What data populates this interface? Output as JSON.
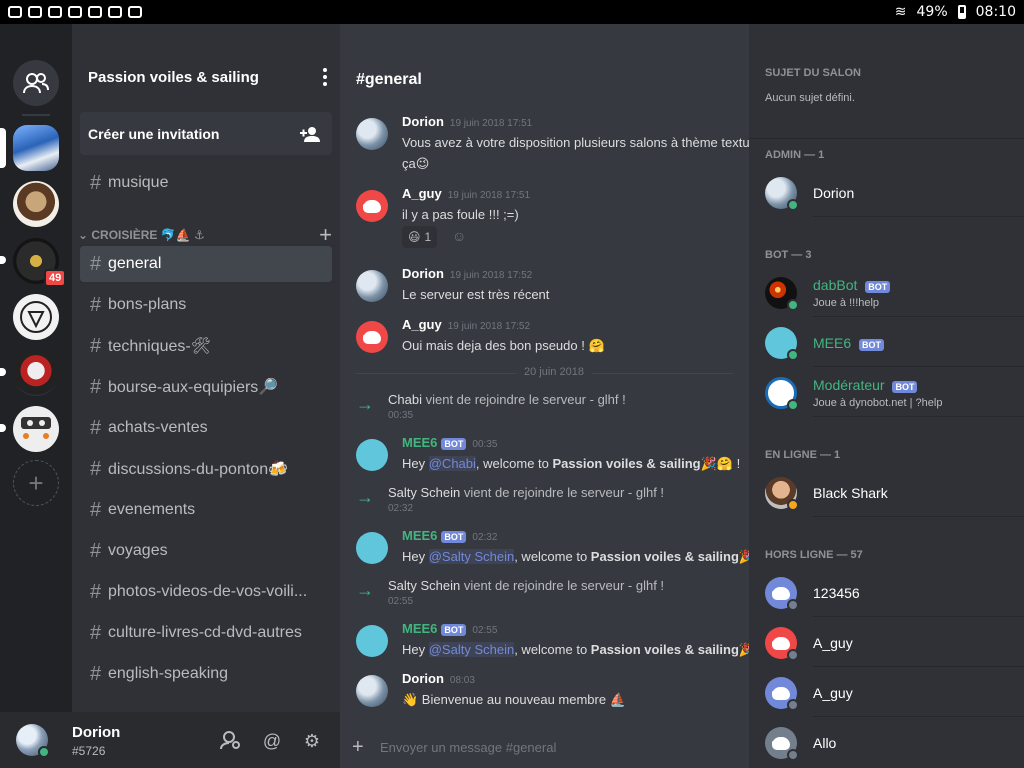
{
  "status_bar": {
    "battery": "49%",
    "time": "08:10"
  },
  "server": {
    "name": "Passion voiles & sailing",
    "invite_label": "Créer une invitation"
  },
  "channels_top": [
    {
      "name": "musique"
    }
  ],
  "category": {
    "name": "CROISIÈRE 🐬⛵ ⚓"
  },
  "channels": [
    {
      "name": "general",
      "active": true
    },
    {
      "name": "bons-plans"
    },
    {
      "name": "techniques-🛠"
    },
    {
      "name": "bourse-aux-equipiers🔎"
    },
    {
      "name": "achats-ventes"
    },
    {
      "name": "discussions-du-ponton🍻"
    },
    {
      "name": "evenements"
    },
    {
      "name": "voyages"
    },
    {
      "name": "photos-videos-de-vos-voili..."
    },
    {
      "name": "culture-livres-cd-dvd-autres"
    },
    {
      "name": "english-speaking"
    }
  ],
  "guild_badge": "49",
  "user": {
    "name": "Dorion",
    "tag": "#5726"
  },
  "chat": {
    "title": "#general",
    "messages": [
      {
        "author": "Dorion",
        "time": "19 juin 2018 17:51",
        "text": "Vous avez à votre disposition plusieurs salons à thème textu",
        "text2": "ça😉"
      },
      {
        "author": "A_guy",
        "time": "19 juin 2018 17:51",
        "text": "il y a pas foule !!! ;=)",
        "reaction_count": "1"
      },
      {
        "author": "Dorion",
        "time": "19 juin 2018 17:52",
        "text": "Le serveur est très récent"
      },
      {
        "author": "A_guy",
        "time": "19 juin 2018 17:52",
        "text": "Oui mais deja des bon pseudo ! 🤗"
      }
    ],
    "date_divider": "20 juin 2018",
    "joins": [
      {
        "name": "Chabi",
        "suffix": "vient de rejoindre le serveur - glhf !",
        "time": "00:35"
      },
      {
        "name": "Salty Schein",
        "suffix": "vient de rejoindre le serveur - glhf !",
        "time": "02:32"
      },
      {
        "name": "Salty Schein",
        "suffix": "vient de rejoindre le serveur - glhf !",
        "time": "02:55"
      }
    ],
    "mee6": [
      {
        "author": "MEE6",
        "time": "00:35",
        "pre": "Hey ",
        "mention": "@Chabi",
        "post": ", welcome to ",
        "server": "Passion voiles & sailing",
        "end": "🎉🤗 !"
      },
      {
        "author": "MEE6",
        "time": "02:32",
        "pre": "Hey ",
        "mention": "@Salty Schein",
        "post": ", welcome to ",
        "server": "Passion voiles & sailing",
        "end": "🎉"
      },
      {
        "author": "MEE6",
        "time": "02:55",
        "pre": "Hey ",
        "mention": "@Salty Schein",
        "post": ", welcome to ",
        "server": "Passion voiles & sailing",
        "end": "🎉"
      }
    ],
    "last": {
      "author": "Dorion",
      "time": "08:03",
      "text": "👋 Bienvenue au nouveau membre ⛵"
    },
    "bot_badge": "BOT",
    "composer_placeholder": "Envoyer un message #general"
  },
  "members": {
    "topic_title": "SUJET DU SALON",
    "topic_text": "Aucun sujet défini.",
    "sections": {
      "admin": "ADMIN — 1",
      "bot": "BOT — 3",
      "online": "EN LIGNE — 1",
      "offline": "HORS LIGNE — 57"
    },
    "admin": [
      {
        "name": "Dorion"
      }
    ],
    "bots": [
      {
        "name": "dabBot",
        "status": "Joue à !!!help"
      },
      {
        "name": "MEE6",
        "status": ""
      },
      {
        "name": "Modérateur",
        "status": "Joue à dynobot.net | ?help"
      }
    ],
    "online": [
      {
        "name": "Black Shark"
      }
    ],
    "offline": [
      {
        "name": "123456"
      },
      {
        "name": "A_guy"
      },
      {
        "name": "A_guy"
      },
      {
        "name": "Allo"
      }
    ],
    "bot_badge": "BOT"
  },
  "colors": {
    "accent": "#7289da",
    "online": "#43b581",
    "idle": "#faa61a",
    "danger": "#f04747"
  }
}
